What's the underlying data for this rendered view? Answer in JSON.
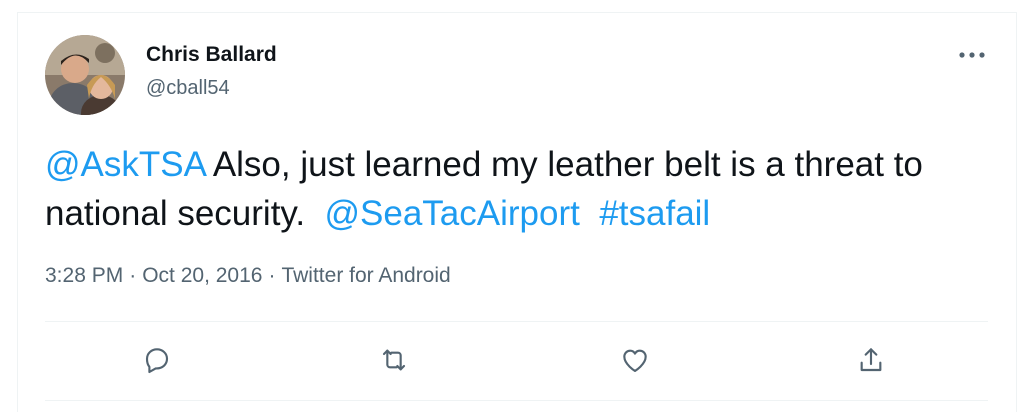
{
  "author": {
    "name": "Chris Ballard",
    "handle": "@cball54"
  },
  "tweet": {
    "mention": "@AskTSA",
    "text": "Also, just learned my leather belt is a threat to national security.",
    "mention2": "@SeaTacAirport",
    "hashtag": "#tsafail"
  },
  "meta": {
    "time": "3:28 PM",
    "date": "Oct 20, 2016",
    "source": "Twitter for Android",
    "separator": "·"
  },
  "icons": {
    "more": "more-options-icon",
    "reply": "reply-icon",
    "retweet": "retweet-icon",
    "like": "like-icon",
    "share": "share-icon"
  },
  "colors": {
    "link": "#1d9bf0",
    "secondary_text": "#536471",
    "primary_text": "#0f1419",
    "divider": "#eff3f4"
  }
}
